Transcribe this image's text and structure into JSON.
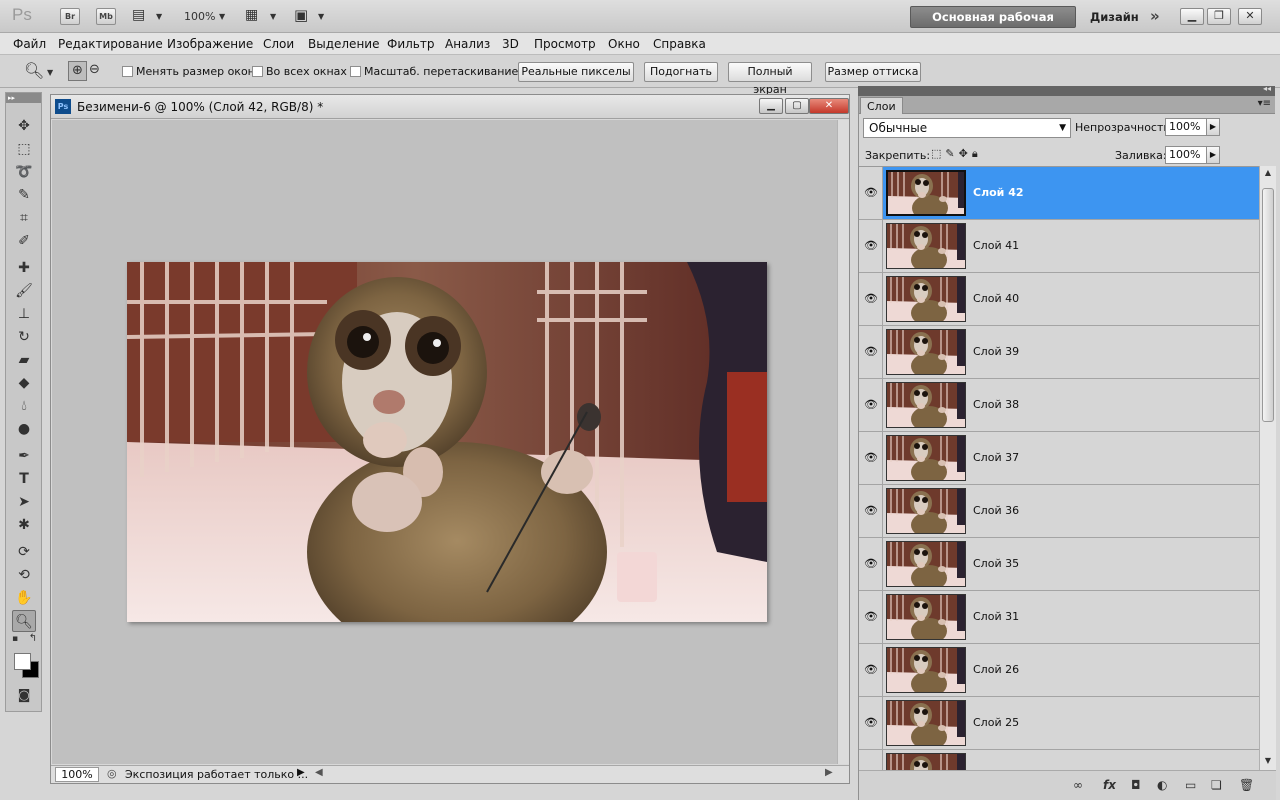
{
  "app": {
    "logo": "Ps",
    "bridge_label": "Br",
    "minibridge_label": "Mb",
    "zoom": "100%",
    "workspace_active": "Основная рабочая среда",
    "workspace_design": "Дизайн",
    "more": "»"
  },
  "menu": [
    "Файл",
    "Редактирование",
    "Изображение",
    "Слои",
    "Выделение",
    "Фильтр",
    "Анализ",
    "3D",
    "Просмотр",
    "Окно",
    "Справка"
  ],
  "options": {
    "check_resize": "Менять размер окон",
    "check_all_windows": "Во всех окнах",
    "check_scrubby": "Масштаб. перетаскиванием",
    "btn_actual": "Реальные пикселы",
    "btn_fit": "Подогнать",
    "btn_fullscreen": "Полный экран",
    "btn_print": "Размер оттиска"
  },
  "document": {
    "title": "Безимени-6 @ 100% (Слой 42, RGB/8) *",
    "ps_badge": "Ps",
    "status_zoom": "100%",
    "status_info": "Экспозиция работает только ..."
  },
  "layers_panel": {
    "tab": "Слои",
    "blend_mode": "Обычные",
    "opacity_label": "Непрозрачность:",
    "opacity_value": "100%",
    "lock_label": "Закрепить:",
    "fill_label": "Заливка:",
    "fill_value": "100%",
    "selected_index": 0,
    "layers": [
      {
        "name": "Слой 42"
      },
      {
        "name": "Слой 41"
      },
      {
        "name": "Слой 40"
      },
      {
        "name": "Слой 39"
      },
      {
        "name": "Слой 38"
      },
      {
        "name": "Слой 37"
      },
      {
        "name": "Слой 36"
      },
      {
        "name": "Слой 35"
      },
      {
        "name": "Слой 31"
      },
      {
        "name": "Слой 26"
      },
      {
        "name": "Слой 25"
      },
      {
        "name": ""
      }
    ],
    "footer_icons": [
      "link-icon",
      "fx-icon",
      "mask-icon",
      "adjustment-icon",
      "group-icon",
      "new-layer-icon",
      "trash-icon"
    ]
  },
  "colors": {
    "selection": "#3d95f1",
    "workspace_button": "#7a7a7a"
  }
}
